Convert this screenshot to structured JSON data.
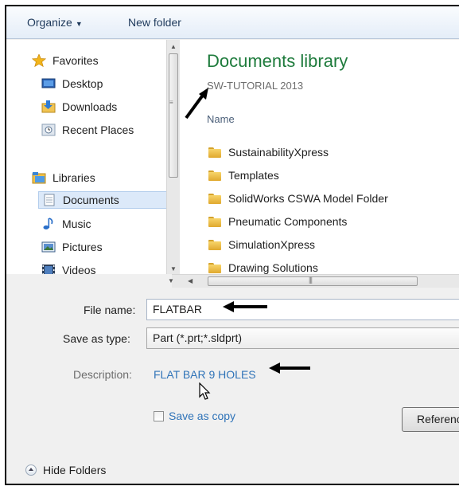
{
  "toolbar": {
    "organize": "Organize",
    "organize_caret": "▼",
    "new_folder": "New folder"
  },
  "nav": {
    "items": [
      {
        "label": "Favorites",
        "icon": "star-icon"
      },
      {
        "label": "Desktop",
        "icon": "desktop-icon"
      },
      {
        "label": "Downloads",
        "icon": "downloads-icon"
      },
      {
        "label": "Recent Places",
        "icon": "recent-places-icon"
      },
      {
        "label": "Libraries",
        "icon": "libraries-icon"
      },
      {
        "label": "Documents",
        "icon": "documents-icon"
      },
      {
        "label": "Music",
        "icon": "music-icon"
      },
      {
        "label": "Pictures",
        "icon": "pictures-icon"
      },
      {
        "label": "Videos",
        "icon": "videos-icon"
      }
    ]
  },
  "files": {
    "title": "Documents library",
    "subtitle": "SW-TUTORIAL 2013",
    "column_name": "Name",
    "folders": [
      "SustainabilityXpress",
      "Templates",
      "SolidWorks CSWA Model Folder",
      "Pneumatic Components",
      "SimulationXpress",
      "Drawing Solutions"
    ]
  },
  "form": {
    "file_name_label": "File name:",
    "file_name_value": "FLATBAR",
    "save_as_type_label": "Save as type:",
    "save_as_type_value": "Part (*.prt;*.sldprt)",
    "description_label": "Description:",
    "description_value": "FLAT BAR 9 HOLES",
    "save_as_copy": "Save as copy",
    "references_button": "References...",
    "hide_folders": "Hide Folders"
  },
  "colors": {
    "library_title": "#1e7b3c",
    "link_blue": "#2f73b8",
    "selection": "#dce9f9"
  }
}
